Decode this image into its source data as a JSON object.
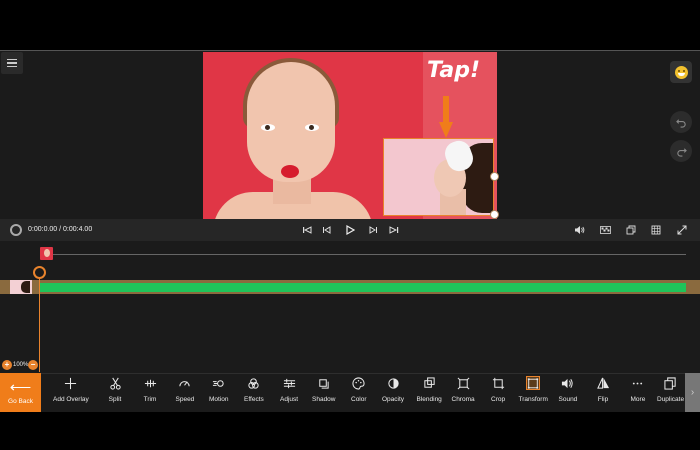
{
  "canvas": {
    "overlay_text": "Tap!"
  },
  "transport": {
    "time": "0:00:0.00 / 0:00:4.00"
  },
  "timeline": {
    "zoom": "100%"
  },
  "toolbar": {
    "go_back": "Go Back",
    "items": [
      {
        "label": "Add Overlay",
        "icon": "plus-icon"
      },
      {
        "label": "Split",
        "icon": "scissors-icon"
      },
      {
        "label": "Trim",
        "icon": "trim-icon"
      },
      {
        "label": "Speed",
        "icon": "speedometer-icon"
      },
      {
        "label": "Motion",
        "icon": "motion-icon"
      },
      {
        "label": "Effects",
        "icon": "effects-icon"
      },
      {
        "label": "Adjust",
        "icon": "sliders-icon"
      },
      {
        "label": "Shadow",
        "icon": "shadow-icon"
      },
      {
        "label": "Color",
        "icon": "palette-icon"
      },
      {
        "label": "Opacity",
        "icon": "opacity-icon"
      },
      {
        "label": "Blending",
        "icon": "blending-icon"
      },
      {
        "label": "Chroma",
        "icon": "chroma-icon"
      },
      {
        "label": "Crop",
        "icon": "crop-icon"
      },
      {
        "label": "Transform",
        "icon": "transform-icon"
      },
      {
        "label": "Sound",
        "icon": "speaker-icon"
      },
      {
        "label": "Flip",
        "icon": "flip-icon"
      },
      {
        "label": "More",
        "icon": "more-icon"
      },
      {
        "label": "Duplicate",
        "icon": "duplicate-icon"
      }
    ],
    "active": "Transform"
  },
  "colors": {
    "accent": "#f07d1a",
    "track": "#1fc45a",
    "preview_bg": "#e03646"
  }
}
